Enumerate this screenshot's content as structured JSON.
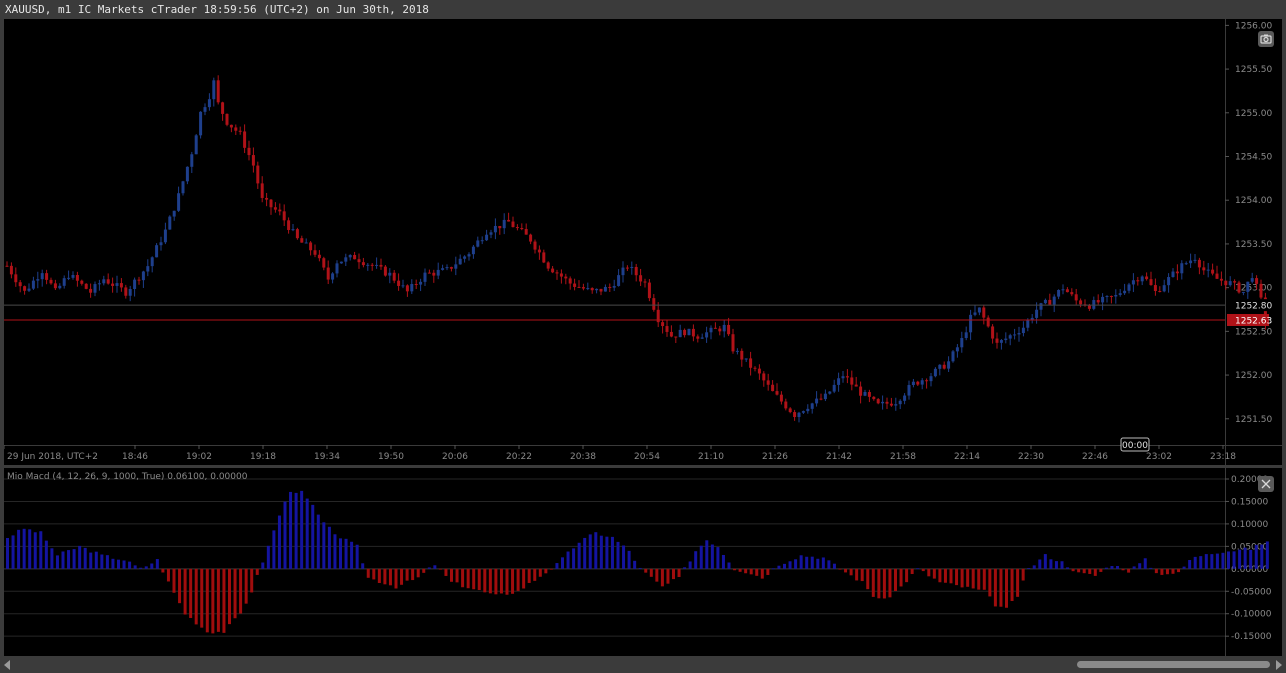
{
  "window": {
    "title": "XAUUSD, m1 IC Markets cTrader 18:59:56 (UTC+2) on Jun 30th, 2018"
  },
  "colors": {
    "bull": "#1e3f8c",
    "bear": "#b01218",
    "grid": "#262626",
    "axis_text": "#8a8a8a",
    "price_line": "#b01218",
    "macd_pos": "#1414a0",
    "macd_neg": "#a00d0d"
  },
  "main_chart": {
    "symbol": "XAUUSD",
    "timeframe": "m1",
    "y_ticks": [
      "1256.00",
      "1255.50",
      "1255.00",
      "1254.50",
      "1254.00",
      "1253.50",
      "1253.00",
      "1252.50",
      "1252.00",
      "1251.50"
    ],
    "y_range": [
      1251.2,
      1256.05
    ],
    "x_ticks": [
      "29 Jun 2018, UTC+2",
      "18:46",
      "19:02",
      "19:18",
      "19:34",
      "19:50",
      "20:06",
      "20:22",
      "20:38",
      "20:54",
      "21:10",
      "21:26",
      "21:42",
      "21:58",
      "22:14",
      "22:30",
      "22:46",
      "23:02",
      "23:18"
    ],
    "ref_price_label": "1252.80",
    "ref_price": 1252.8,
    "current_price_label": "1252.63",
    "current_price": 1252.63,
    "countdown_label": "00:00",
    "price_path": [
      [
        0,
        1253.25
      ],
      [
        4,
        1252.95
      ],
      [
        8,
        1253.2
      ],
      [
        11,
        1252.95
      ],
      [
        14,
        1253.15
      ],
      [
        19,
        1252.95
      ],
      [
        22,
        1253.1
      ],
      [
        27,
        1252.95
      ],
      [
        32,
        1253.25
      ],
      [
        36,
        1253.65
      ],
      [
        39,
        1254.05
      ],
      [
        42,
        1254.55
      ],
      [
        44,
        1255.0
      ],
      [
        46,
        1255.2
      ],
      [
        47,
        1255.35
      ],
      [
        48,
        1255.1
      ],
      [
        50,
        1254.9
      ],
      [
        53,
        1254.75
      ],
      [
        56,
        1254.4
      ],
      [
        58,
        1254.0
      ],
      [
        62,
        1253.85
      ],
      [
        66,
        1253.55
      ],
      [
        70,
        1253.4
      ],
      [
        73,
        1253.1
      ],
      [
        75,
        1253.3
      ],
      [
        79,
        1253.35
      ],
      [
        83,
        1253.25
      ],
      [
        87,
        1253.15
      ],
      [
        91,
        1252.95
      ],
      [
        95,
        1253.15
      ],
      [
        100,
        1253.2
      ],
      [
        105,
        1253.4
      ],
      [
        109,
        1253.65
      ],
      [
        114,
        1253.75
      ],
      [
        119,
        1253.55
      ],
      [
        123,
        1253.25
      ],
      [
        128,
        1253.05
      ],
      [
        133,
        1252.95
      ],
      [
        137,
        1253.0
      ],
      [
        141,
        1253.25
      ],
      [
        145,
        1253.05
      ],
      [
        148,
        1252.65
      ],
      [
        151,
        1252.45
      ],
      [
        154,
        1252.5
      ],
      [
        157,
        1252.45
      ],
      [
        160,
        1252.5
      ],
      [
        163,
        1252.55
      ],
      [
        165,
        1252.3
      ],
      [
        168,
        1252.15
      ],
      [
        171,
        1252.0
      ],
      [
        174,
        1251.8
      ],
      [
        177,
        1251.65
      ],
      [
        179,
        1251.55
      ],
      [
        182,
        1251.65
      ],
      [
        186,
        1251.75
      ],
      [
        190,
        1252.0
      ],
      [
        194,
        1251.8
      ],
      [
        198,
        1251.65
      ],
      [
        202,
        1251.7
      ],
      [
        206,
        1251.9
      ],
      [
        210,
        1252.0
      ],
      [
        214,
        1252.15
      ],
      [
        217,
        1252.4
      ],
      [
        219,
        1252.65
      ],
      [
        221,
        1252.75
      ],
      [
        223,
        1252.55
      ],
      [
        225,
        1252.35
      ],
      [
        228,
        1252.45
      ],
      [
        231,
        1252.55
      ],
      [
        234,
        1252.75
      ],
      [
        237,
        1252.85
      ],
      [
        240,
        1253.0
      ],
      [
        243,
        1252.85
      ],
      [
        246,
        1252.8
      ],
      [
        249,
        1252.85
      ],
      [
        252,
        1252.9
      ],
      [
        255,
        1253.05
      ],
      [
        258,
        1253.15
      ],
      [
        261,
        1252.95
      ],
      [
        264,
        1253.1
      ],
      [
        267,
        1253.25
      ],
      [
        270,
        1253.35
      ],
      [
        272,
        1253.2
      ],
      [
        275,
        1253.1
      ],
      [
        278,
        1253.05
      ],
      [
        281,
        1252.95
      ],
      [
        283,
        1253.15
      ],
      [
        285,
        1252.85
      ],
      [
        286,
        1252.63
      ]
    ]
  },
  "macd_panel": {
    "label": "Mio Macd (4, 12, 26, 9, 1000, True) 0.06100, 0.00000",
    "y_ticks": [
      "0.20000",
      "0.15000",
      "0.10000",
      "0.05000",
      "0.00000",
      "-0.05000",
      "-0.10000",
      "-0.15000"
    ],
    "y_range": [
      -0.183,
      0.2
    ],
    "hist_path": [
      [
        0,
        0.07
      ],
      [
        3,
        0.09
      ],
      [
        6,
        0.08
      ],
      [
        9,
        0.03
      ],
      [
        13,
        0.05
      ],
      [
        17,
        0.03
      ],
      [
        21,
        0.02
      ],
      [
        24,
        0.0
      ],
      [
        27,
        0.02
      ],
      [
        29,
        -0.03
      ],
      [
        32,
        -0.1
      ],
      [
        36,
        -0.14
      ],
      [
        39,
        -0.14
      ],
      [
        42,
        -0.1
      ],
      [
        44,
        -0.05
      ],
      [
        47,
        0.05
      ],
      [
        49,
        0.12
      ],
      [
        51,
        0.175
      ],
      [
        53,
        0.17
      ],
      [
        55,
        0.14
      ],
      [
        57,
        0.1
      ],
      [
        60,
        0.07
      ],
      [
        63,
        0.05
      ],
      [
        65,
        -0.02
      ],
      [
        70,
        -0.04
      ],
      [
        74,
        -0.02
      ],
      [
        77,
        0.01
      ],
      [
        80,
        -0.03
      ],
      [
        84,
        -0.045
      ],
      [
        88,
        -0.06
      ],
      [
        92,
        -0.05
      ],
      [
        95,
        -0.025
      ],
      [
        99,
        0.01
      ],
      [
        103,
        0.06
      ],
      [
        106,
        0.08
      ],
      [
        109,
        0.07
      ],
      [
        112,
        0.04
      ],
      [
        114,
        0.0
      ],
      [
        118,
        -0.04
      ],
      [
        121,
        -0.02
      ],
      [
        124,
        0.04
      ],
      [
        126,
        0.065
      ],
      [
        128,
        0.05
      ],
      [
        131,
        0.0
      ],
      [
        134,
        -0.01
      ],
      [
        136,
        -0.02
      ],
      [
        139,
        0.01
      ],
      [
        143,
        0.03
      ],
      [
        147,
        0.025
      ],
      [
        150,
        0.0
      ],
      [
        154,
        -0.03
      ],
      [
        156,
        -0.06
      ],
      [
        158,
        -0.07
      ],
      [
        161,
        -0.04
      ],
      [
        164,
        0.0
      ],
      [
        168,
        -0.03
      ],
      [
        172,
        -0.04
      ],
      [
        176,
        -0.05
      ],
      [
        178,
        -0.08
      ],
      [
        180,
        -0.09
      ],
      [
        182,
        -0.06
      ],
      [
        184,
        0.0
      ],
      [
        187,
        0.03
      ],
      [
        190,
        0.015
      ],
      [
        193,
        -0.01
      ],
      [
        196,
        -0.015
      ],
      [
        199,
        0.01
      ],
      [
        202,
        -0.005
      ],
      [
        205,
        0.02
      ],
      [
        207,
        -0.01
      ],
      [
        211,
        -0.01
      ],
      [
        213,
        0.02
      ],
      [
        216,
        0.035
      ],
      [
        220,
        0.04
      ],
      [
        224,
        0.045
      ],
      [
        227,
        0.061
      ]
    ]
  }
}
